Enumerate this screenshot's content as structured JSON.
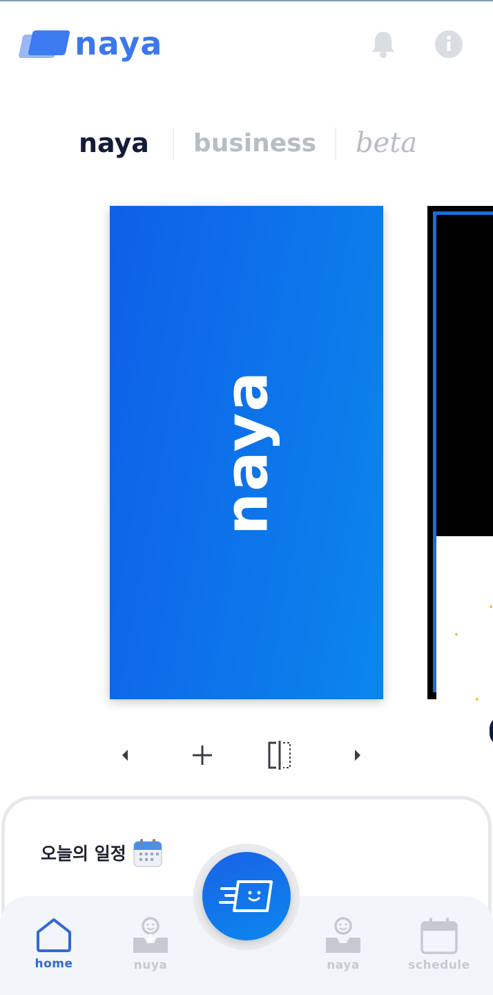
{
  "app": {
    "logo_text": "naya"
  },
  "header": {
    "bell_icon": "bell-icon",
    "info_icon": "info-icon"
  },
  "brand_tabs": [
    {
      "label": "naya",
      "active": true
    },
    {
      "label": "business",
      "active": false
    },
    {
      "label": "beta",
      "active": false
    }
  ],
  "cards": [
    {
      "logo_text": "naya",
      "background": "#0f5fe8"
    },
    {
      "background": "#000000"
    }
  ],
  "controls": {
    "prev_icon": "chevron-left-icon",
    "add_icon": "plus-icon",
    "split_icon": "split-view-icon",
    "next_icon": "chevron-right-icon"
  },
  "schedule": {
    "title": "오늘의 일정",
    "icon": "calendar-icon"
  },
  "bottom_nav": {
    "items": [
      {
        "label": "home",
        "icon": "home-icon",
        "active": true
      },
      {
        "label": "nuya",
        "icon": "inbox-person-icon",
        "active": false
      },
      {
        "label": "naya",
        "icon": "inbox-person-icon",
        "active": false
      },
      {
        "label": "schedule",
        "icon": "calendar-icon",
        "active": false
      }
    ],
    "fab_icon": "fast-card-icon"
  },
  "colors": {
    "accent": "#3b78ee",
    "active_nav": "#3467d6",
    "inactive": "#c6cad0",
    "nav_bg": "#f2f5f9"
  }
}
